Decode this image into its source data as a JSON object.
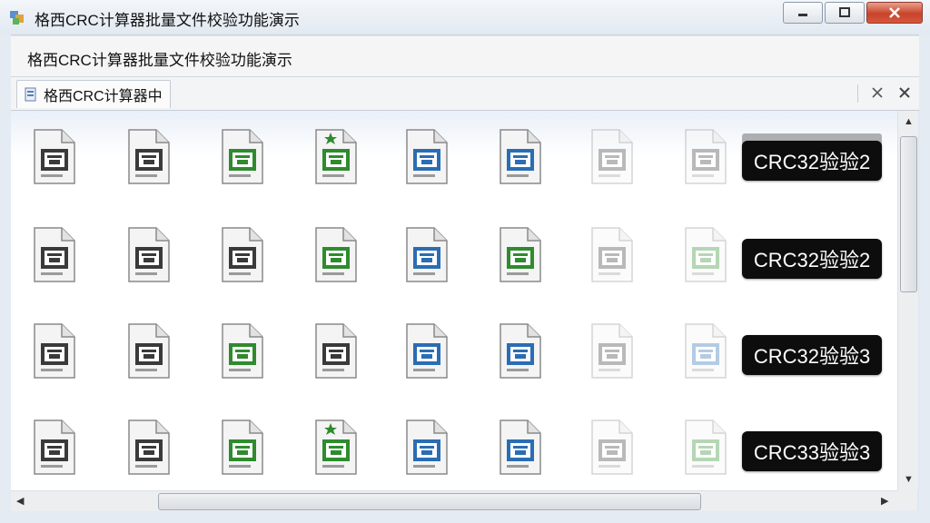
{
  "window": {
    "title": "格西CRC计算器批量文件校验功能演示"
  },
  "header": {
    "text": "格西CRC计算器批量文件校验功能演示"
  },
  "tab": {
    "label": "格西CRC计算器中"
  },
  "rows": [
    {
      "label": "CRC32验验2",
      "icons": [
        "doc-gray",
        "doc-gray",
        "doc-green",
        "doc-green-star",
        "doc-blue",
        "doc-blue",
        "doc-gray-faded",
        "doc-gray-faded"
      ]
    },
    {
      "label": "CRC32验验2",
      "icons": [
        "doc-gray",
        "doc-gray",
        "doc-gray",
        "doc-green",
        "doc-blue",
        "doc-green",
        "doc-gray-faded",
        "doc-green-faded"
      ]
    },
    {
      "label": "CRC32验验3",
      "icons": [
        "doc-gray",
        "doc-gray",
        "doc-green",
        "doc-gray",
        "doc-blue",
        "doc-blue",
        "doc-gray-faded",
        "doc-blue-faded"
      ]
    },
    {
      "label": "CRC33验验3",
      "icons": [
        "doc-gray",
        "doc-gray",
        "doc-green",
        "doc-green-star",
        "doc-blue",
        "doc-blue",
        "doc-gray-faded",
        "doc-green-faded"
      ]
    }
  ],
  "colors": {
    "gray": "#3a3a3a",
    "green": "#2e8b2e",
    "blue": "#2a6db5",
    "label_bg": "#0d0d0d"
  }
}
